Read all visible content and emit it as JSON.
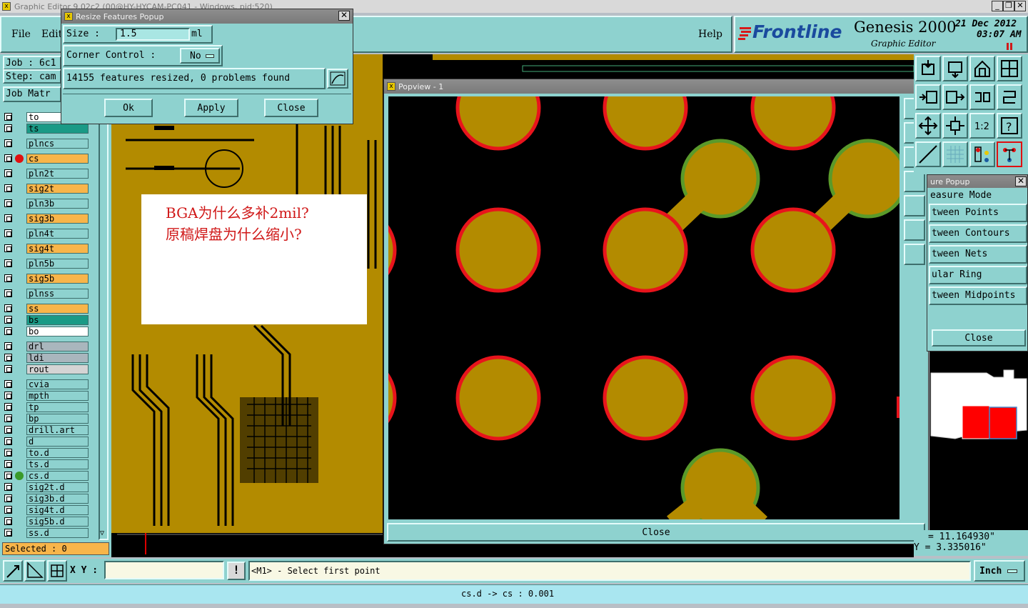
{
  "app": {
    "title": "Graphic Editor 9.02c2 (00@HY-HYCAM-PC041 - Windows, pid:520)",
    "minimize": "_",
    "restore": "❐",
    "close": "✕"
  },
  "menu": {
    "file": "File",
    "edit": "Edit",
    "help": "Help"
  },
  "brand": {
    "logo": "Frontline",
    "product": "Genesis 2000",
    "subtitle": "Graphic Editor",
    "date": "21 Dec 2012",
    "time": "03:07 AM"
  },
  "job": {
    "job_label": "Job : 6c1",
    "step_label": "Step: cam",
    "matrix_button": "Job Matr"
  },
  "layers": [
    {
      "name": "to",
      "color": "#ffffff"
    },
    {
      "name": "ts",
      "color": "#1a9a86"
    },
    {
      "name": "plncs",
      "color": "#8ed2cf"
    },
    {
      "name": "cs",
      "color": "#f8b54a",
      "active": true
    },
    {
      "name": "pln2t",
      "color": "#8ed2cf"
    },
    {
      "name": "sig2t",
      "color": "#f8b54a"
    },
    {
      "name": "pln3b",
      "color": "#8ed2cf"
    },
    {
      "name": "sig3b",
      "color": "#f8b54a"
    },
    {
      "name": "pln4t",
      "color": "#8ed2cf"
    },
    {
      "name": "sig4t",
      "color": "#f8b54a"
    },
    {
      "name": "pln5b",
      "color": "#8ed2cf"
    },
    {
      "name": "sig5b",
      "color": "#f8b54a"
    },
    {
      "name": "plnss",
      "color": "#8ed2cf"
    },
    {
      "name": "ss",
      "color": "#f8b54a"
    },
    {
      "name": "bs",
      "color": "#1a9a86"
    },
    {
      "name": "bo",
      "color": "#ffffff"
    },
    {
      "name": "drl",
      "color": "#a9b6bd"
    },
    {
      "name": "ldi",
      "color": "#a9b6bd"
    },
    {
      "name": "rout",
      "color": "#d4d4d4"
    },
    {
      "name": "cvia",
      "color": "#8ed2cf"
    },
    {
      "name": "mpth",
      "color": "#8ed2cf"
    },
    {
      "name": "tp",
      "color": "#8ed2cf"
    },
    {
      "name": "bp",
      "color": "#8ed2cf"
    },
    {
      "name": "drill.art",
      "color": "#8ed2cf"
    },
    {
      "name": "d",
      "color": "#8ed2cf"
    },
    {
      "name": "to.d",
      "color": "#8ed2cf"
    },
    {
      "name": "ts.d",
      "color": "#8ed2cf"
    },
    {
      "name": "cs.d",
      "color": "#8ed2cf"
    },
    {
      "name": "sig2t.d",
      "color": "#8ed2cf"
    },
    {
      "name": "sig3b.d",
      "color": "#8ed2cf"
    },
    {
      "name": "sig4t.d",
      "color": "#8ed2cf"
    },
    {
      "name": "sig5b.d",
      "color": "#8ed2cf"
    },
    {
      "name": "ss.d",
      "color": "#8ed2cf"
    }
  ],
  "selected": "Selected : 0",
  "resize_popup": {
    "title": "Resize Features Popup",
    "size_label": "Size :",
    "size_value": "1.5",
    "size_unit": "ml",
    "corner_label": "Corner Control :",
    "corner_value": "No",
    "result": "14155 features resized, 0 problems found",
    "ok": "Ok",
    "apply": "Apply",
    "close": "Close"
  },
  "annotation": {
    "line1": "BGA为什么多补2mil?",
    "line2": "原稿焊盘为什么缩小?"
  },
  "popview": {
    "title": "Popview - 1",
    "close": "Close"
  },
  "measure": {
    "title": "ure Popup",
    "mode": "easure Mode",
    "items": [
      "tween Points",
      "tween Contours",
      "tween Nets",
      "ular Ring",
      "tween Midpoints"
    ],
    "close": "Close"
  },
  "coords": {
    "x": "= 11.164930\"",
    "y": "Y = 3.335016\""
  },
  "status": {
    "xy_label": "X Y :",
    "xy_value": "",
    "prompt": "<M1> - Select first point",
    "unit": "Inch",
    "bottom": "cs.d -> cs : 0.001"
  }
}
